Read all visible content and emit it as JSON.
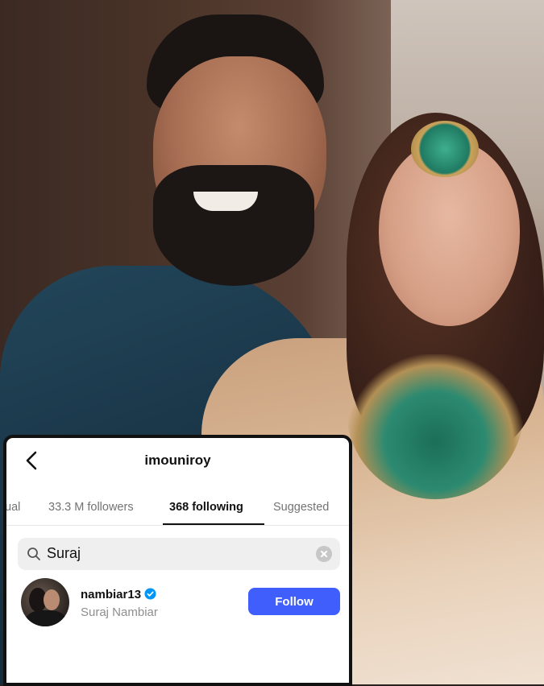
{
  "screen": {
    "title": "imouniroy",
    "icons": {
      "back": "chevron-left-icon",
      "search": "search-icon",
      "clear": "clear-icon",
      "verified": "verified-badge-icon"
    },
    "tabs": [
      {
        "label": "ual"
      },
      {
        "label": "33.3 M followers"
      },
      {
        "label": "368 following",
        "active": true
      },
      {
        "label": "Suggested"
      }
    ],
    "search": {
      "value": "Suraj"
    },
    "result": {
      "username": "nambiar13",
      "full_name": "Suraj Nambiar",
      "verified": true,
      "button_label": "Follow"
    },
    "colors": {
      "follow_button": "#3f5efb",
      "verified": "#0095f6"
    }
  }
}
